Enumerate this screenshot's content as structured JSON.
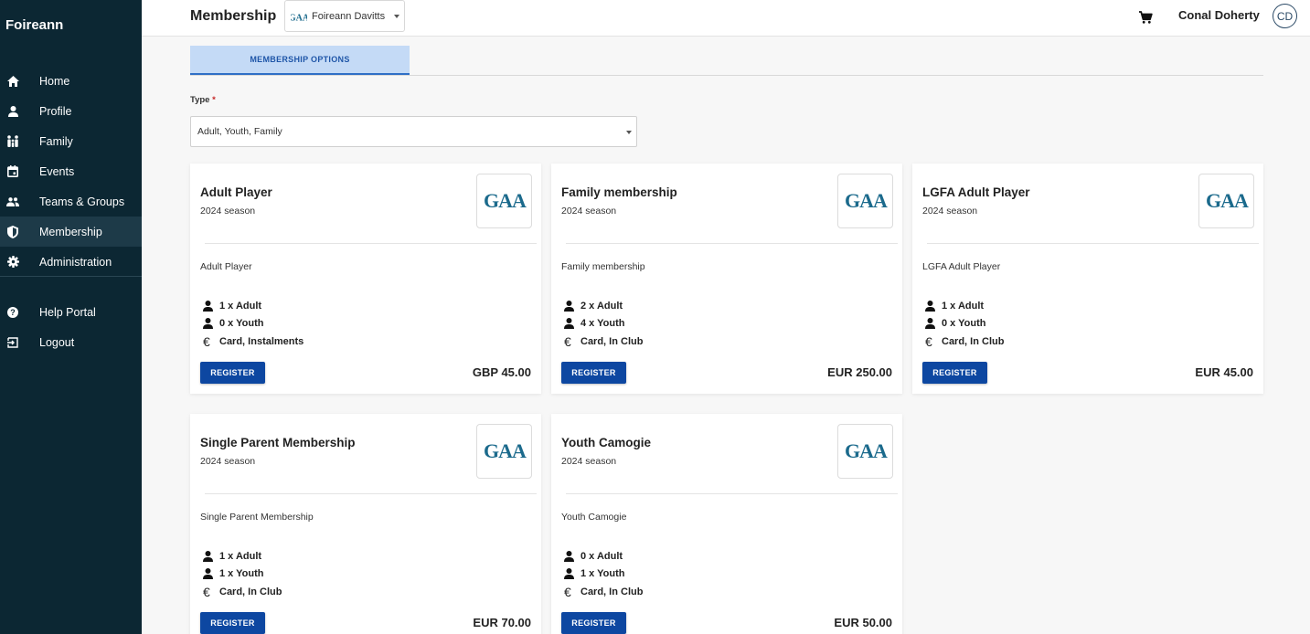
{
  "sidebar": {
    "brand": "Foireann",
    "items": [
      {
        "label": "Home",
        "icon": "home-icon"
      },
      {
        "label": "Profile",
        "icon": "person-icon"
      },
      {
        "label": "Family",
        "icon": "family-icon"
      },
      {
        "label": "Events",
        "icon": "calendar-icon"
      },
      {
        "label": "Teams & Groups",
        "icon": "group-icon"
      },
      {
        "label": "Membership",
        "icon": "shield-icon",
        "active": true
      },
      {
        "label": "Administration",
        "icon": "gear-icon"
      }
    ],
    "secondary": [
      {
        "label": "Help Portal",
        "icon": "help-icon"
      },
      {
        "label": "Logout",
        "icon": "logout-icon"
      }
    ]
  },
  "header": {
    "title": "Membership",
    "club_select": "Foireann Davitts",
    "user_name": "Conal Doherty",
    "avatar_initials": "CD"
  },
  "tabs": [
    {
      "label": "MEMBERSHIP OPTIONS",
      "active": true
    }
  ],
  "filter": {
    "label": "Type",
    "required_mark": "*",
    "value": "Adult, Youth, Family"
  },
  "cards": [
    {
      "title": "Adult Player",
      "season": "2024 season",
      "description": "Adult Player",
      "adults": "1 x Adult",
      "youth": "0 x Youth",
      "payment": "Card, Instalments",
      "button": "REGISTER",
      "price": "GBP 45.00"
    },
    {
      "title": "Family membership",
      "season": "2024 season",
      "description": "Family membership",
      "adults": "2 x Adult",
      "youth": "4 x Youth",
      "payment": "Card, In Club",
      "button": "REGISTER",
      "price": "EUR 250.00"
    },
    {
      "title": "LGFA Adult Player",
      "season": "2024 season",
      "description": "LGFA Adult Player",
      "adults": "1 x Adult",
      "youth": "0 x Youth",
      "payment": "Card, In Club",
      "button": "REGISTER",
      "price": "EUR 45.00"
    },
    {
      "title": "Single Parent Membership",
      "season": "2024 season",
      "description": "Single Parent Membership",
      "adults": "1 x Adult",
      "youth": "1 x Youth",
      "payment": "Card, In Club",
      "button": "REGISTER",
      "price": "EUR 70.00"
    },
    {
      "title": "Youth Camogie",
      "season": "2024 season",
      "description": "Youth Camogie",
      "adults": "0 x Adult",
      "youth": "1 x Youth",
      "payment": "Card, In Club",
      "button": "REGISTER",
      "price": "EUR 50.00"
    }
  ],
  "colors": {
    "sidebar_bg": "#0c2733",
    "accent": "#0d47a1",
    "tab_bg": "#c4daf6",
    "gaa_logo": "#1b6a8c"
  }
}
